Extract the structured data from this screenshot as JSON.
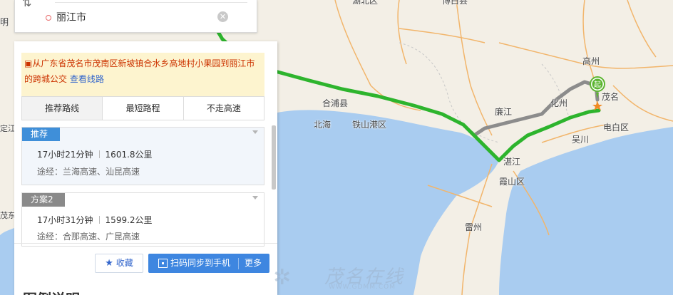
{
  "search": {
    "destination": "丽江市",
    "clear_icon": "clear-icon",
    "swap_icon": "swap-icon"
  },
  "notice": {
    "text": "从广东省茂名市茂南区新坡镇合水乡高地村小果园到丽江市的跨城公交",
    "link": "查看线路"
  },
  "tabs": [
    "推荐路线",
    "最短路程",
    "不走高速"
  ],
  "plans": [
    {
      "badge": "推荐",
      "duration": "17小时21分钟",
      "distance": "1601.8公里",
      "via": "途经：兰海高速、汕昆高速"
    },
    {
      "badge": "方案2",
      "duration": "17小时31分钟",
      "distance": "1599.2公里",
      "via": "途经：合那高速、广昆高速"
    }
  ],
  "actions": {
    "favorite": "收藏",
    "scan_sync": "扫码同步到手机",
    "more": "更多"
  },
  "bottom_heading": "图例说明",
  "map": {
    "start_marker": "起",
    "labels": {
      "hubei": "湖北区",
      "bobai": "博白县",
      "haokang": "明",
      "gaozhou": "高州",
      "maoming": "茂名",
      "hepu": "合浦县",
      "beihai": "北海",
      "tieshangang": "铁山港区",
      "lianjiang": "廉江",
      "huazhou": "化州",
      "zhanjiang": "湛江",
      "wuchuan": "吴川",
      "dianbai": "电白区",
      "xiashan": "霞山区",
      "leizhou": "雷州",
      "dingan": "定江",
      "lumao": "茂东"
    },
    "colors": {
      "recommended_route": "#2db42d",
      "alt_route": "#8c8c8c",
      "sea": "#a9ccf0",
      "land": "#f3efe6"
    }
  },
  "watermark": {
    "title": "茂名在线",
    "url": "WWW.GDMM.COM"
  }
}
